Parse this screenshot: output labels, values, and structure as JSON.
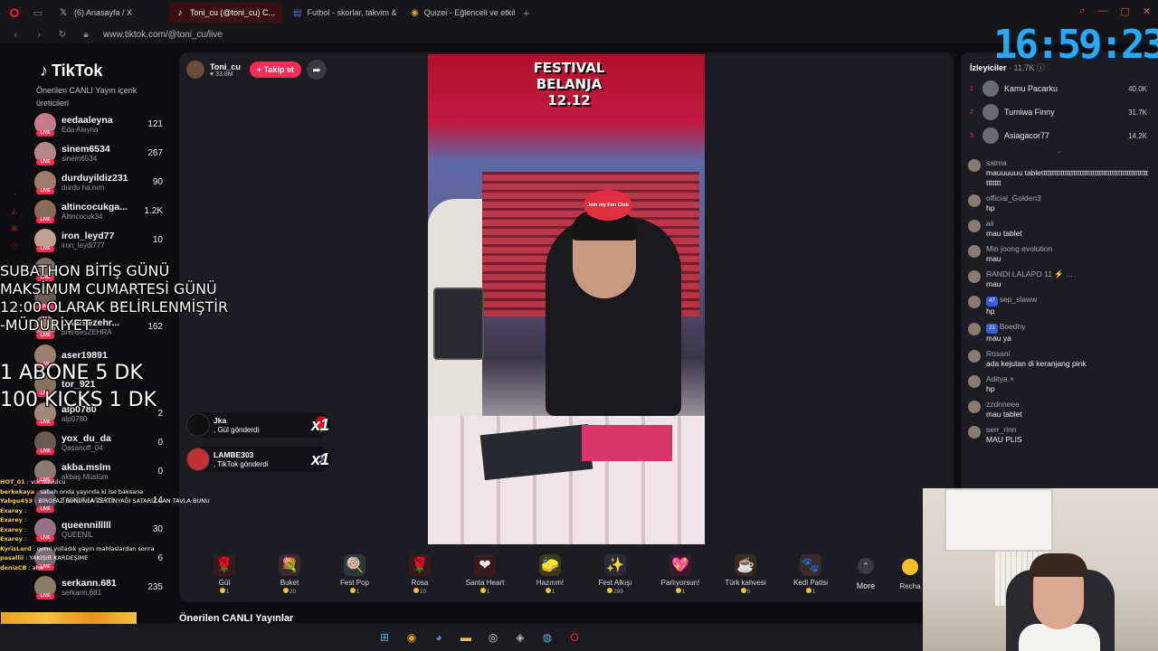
{
  "browser": {
    "tabs": [
      {
        "icon": "𝕏",
        "label": "(6) Anasayfa / X",
        "active": false
      },
      {
        "icon": "♪",
        "label": "Toni_cu (@toni_cu) C...",
        "active": true
      },
      {
        "icon": "▤",
        "label": "Futbol - skorlar, takvim &",
        "active": false
      },
      {
        "icon": "◉",
        "label": "Quizei - Eğlenceli ve etkil",
        "active": false
      }
    ],
    "new_tab": "+",
    "url": "www.tiktok.com/@toni_cu/live"
  },
  "sidebar": {
    "logo": "TikTok",
    "heading": "Önerilen CANLI Yayın içerik üreticileri",
    "creators": [
      {
        "name": "eedaaleyna",
        "sub": "Eda Aleyna",
        "count": "121",
        "avatar_color": "#c47a8a"
      },
      {
        "name": "sinem6534",
        "sub": "sinem6534",
        "count": "267",
        "avatar_color": "#b8868a"
      },
      {
        "name": "durduyildiz231",
        "sub": "durdu ha.nım",
        "count": "90",
        "avatar_color": "#a07a6a"
      },
      {
        "name": "altincocukga...",
        "sub": "Altincocuk34",
        "count": "1.2K",
        "avatar_color": "#8a6a5a"
      },
      {
        "name": "iron_leyd77",
        "sub": "iron_leydi777",
        "count": "10",
        "avatar_color": "#c0a090"
      },
      {
        "name": "",
        "sub": "",
        "count": "",
        "avatar_color": "#7a6a6a"
      },
      {
        "name": "",
        "sub": "",
        "count": "",
        "avatar_color": "#6a5a5a"
      },
      {
        "name": "prensezehr...",
        "sub": "prensesZEHRA",
        "count": "162",
        "avatar_color": "#b07a80"
      },
      {
        "name": "aser19891",
        "sub": "",
        "count": "",
        "avatar_color": "#9a8070"
      },
      {
        "name": "tor_921",
        "sub": "",
        "count": "",
        "avatar_color": "#8a7060"
      },
      {
        "name": "alp0780",
        "sub": "alp0780",
        "count": "2",
        "avatar_color": "#a08878"
      },
      {
        "name": "yox_du_da",
        "sub": "Qasanoff_04",
        "count": "0",
        "avatar_color": "#6a5a50"
      },
      {
        "name": "akba.mslm",
        "sub": "akbaş Müslüm",
        "count": "0",
        "avatar_color": "#8a7a70"
      },
      {
        "name": "",
        "sub": "TAROT MASALI",
        "count": "14",
        "avatar_color": "#5a4a60"
      },
      {
        "name": "queennilllll",
        "sub": "QUEENİL",
        "count": "30",
        "avatar_color": "#9a7088"
      },
      {
        "name": "",
        "sub": "",
        "count": "6",
        "avatar_color": "#7a6a70"
      },
      {
        "name": "serkann.681",
        "sub": "serkann.681",
        "count": "235",
        "avatar_color": "#8a7a6a"
      }
    ]
  },
  "overlay": {
    "subathon": "SUBATHON BİTİŞ GÜNÜ\nMAKSİMUM CUMARTESİ GÜNÜ\n12:00 OLARAK BELİRLENMİŞTİR\n-MÜDÜRİYET",
    "rates": "1 ABONE 5 DK\n100 KICKS  1 DK",
    "chat": [
      {
        "user": "HOT_01",
        "text": "vur davulcu"
      },
      {
        "user": "berkekaya",
        "text": "sabah onda yayında ki ise baksana"
      },
      {
        "user": "Yabgu453",
        "text": "BİROFAZ BUNUNLA ZEYTİNYAĞI SATARIZ LAN TAVLA BUNU"
      },
      {
        "user": "Exarey",
        "text": ""
      },
      {
        "user": "Exarey",
        "text": ""
      },
      {
        "user": "Exarey",
        "text": ""
      },
      {
        "user": "Exarey",
        "text": ""
      },
      {
        "user": "KyrisLord",
        "text": "gemi yolladık yayın mahlaslardan sonra"
      },
      {
        "user": "pasallii",
        "text": "YAKIŞIR KARDEŞİME"
      },
      {
        "user": "denizCB",
        "text": "aha"
      }
    ]
  },
  "stream": {
    "streamer_name": "Toni_cu",
    "likes": "33.8M",
    "follow_label": "+ Takip et",
    "video_banner": "FESTIVAL\nBELANJA\n12.12",
    "fan_badge": "Join my Fan Club",
    "gift_notifications": [
      {
        "user": "Jka",
        "action": ", Gül gönderdi",
        "icon": "🌹",
        "mult": "x1"
      },
      {
        "user": "LAMBE303",
        "action": ", TikTok gönderdi",
        "icon": "♪",
        "mult": "x1"
      }
    ],
    "gifts": [
      {
        "name": "Gül",
        "price": "1",
        "icon": "🌹",
        "color": "#3a1a22"
      },
      {
        "name": "Buket",
        "price": "20",
        "icon": "💐",
        "color": "#3a2a30"
      },
      {
        "name": "Fest Pop",
        "price": "1",
        "icon": "🍭",
        "color": "#2a3a3a"
      },
      {
        "name": "Rosa",
        "price": "10",
        "icon": "🌹",
        "color": "#3a1a1a"
      },
      {
        "name": "Santa Heart",
        "price": "1",
        "icon": "❤",
        "color": "#3a1a1a"
      },
      {
        "name": "Hazırım!",
        "price": "1",
        "icon": "🧽",
        "color": "#3a3a1a"
      },
      {
        "name": "Fest Alkışı",
        "price": "299",
        "icon": "✨",
        "color": "#2a2a3a"
      },
      {
        "name": "Parlıyorsun!",
        "price": "1",
        "icon": "💖",
        "color": "#3a1a2a"
      },
      {
        "name": "Türk kahvesi",
        "price": "5",
        "icon": "☕",
        "color": "#3a2a1a"
      },
      {
        "name": "Kedi Patisi",
        "price": "1",
        "icon": "🐾",
        "color": "#3a2a2a"
      }
    ],
    "more_label": "More",
    "recharge_label": "Recha",
    "recommended_label": "Önerilen CANLI Yayınlar"
  },
  "right_panel": {
    "viewers_label": "İzleyiciler",
    "viewers_count": "· 11.7K",
    "top_viewers": [
      {
        "rank": "1",
        "name": "Kamu Pacarku",
        "coins": "40.0K"
      },
      {
        "rank": "2",
        "name": "Tumiwa Finny",
        "coins": "31.7K"
      },
      {
        "rank": "3",
        "name": "Asiagacor77",
        "coins": "14.2K"
      }
    ],
    "messages": [
      {
        "user": "salma",
        "text": "mauuuuuu tablettttttttttttttttttttttttttttttttttttttttttttttttttttttttt"
      },
      {
        "user": "official_Golden3",
        "text": "hp"
      },
      {
        "user": "aii",
        "text": "mau tablet"
      },
      {
        "user": "Min joong evolution",
        "text": "mau"
      },
      {
        "user": "RANDI LALAPO 11 ⚡ ...",
        "text": "mau"
      },
      {
        "user": "sep_slaww",
        "badge": "47",
        "text": "hp"
      },
      {
        "user": "Boedhy",
        "badge": "21",
        "text": "mau ya"
      },
      {
        "user": "Rosani",
        "text": "ada kejutan di keranjang pink"
      },
      {
        "user": "Aditya ×",
        "text": "hp"
      },
      {
        "user": "zzdnneee",
        "text": "mau tablet"
      },
      {
        "user": "serr_rinn",
        "text": "MAU PLIS"
      }
    ]
  },
  "clock": "16:59:23",
  "colors": {
    "accent": "#fe2c55",
    "clock": "#2aa8f0",
    "opera": "#ff1b2d"
  },
  "taskbar": [
    {
      "name": "windows-start",
      "icon": "⊞",
      "color": "#4ab0f0"
    },
    {
      "name": "chrome",
      "icon": "◉",
      "color": "#e8a020"
    },
    {
      "name": "discord",
      "icon": "◕",
      "color": "#7a80f0"
    },
    {
      "name": "file-explorer",
      "icon": "▬",
      "color": "#f0c040"
    },
    {
      "name": "obs",
      "icon": "◎",
      "color": "#dddddd"
    },
    {
      "name": "app",
      "icon": "◈",
      "color": "#bbbbbb"
    },
    {
      "name": "steam",
      "icon": "◍",
      "color": "#66aadd"
    },
    {
      "name": "opera",
      "icon": "O",
      "color": "#ff1b2d"
    }
  ]
}
